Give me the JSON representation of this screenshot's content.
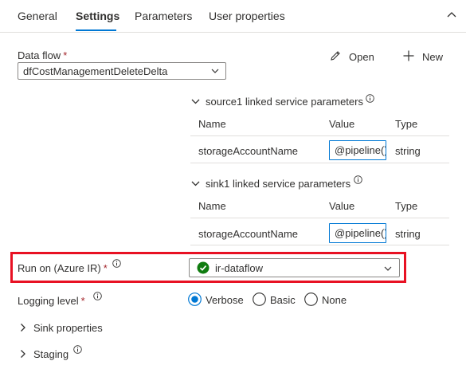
{
  "tabs": [
    {
      "label": "General"
    },
    {
      "label": "Settings"
    },
    {
      "label": "Parameters"
    },
    {
      "label": "User properties"
    }
  ],
  "active_tab": "Settings",
  "data_flow": {
    "label": "Data flow",
    "required_mark": "*",
    "selected": "dfCostManagementDeleteDelta",
    "open_label": "Open",
    "new_label": "New"
  },
  "source_params": {
    "title": "source1 linked service parameters",
    "columns": [
      "Name",
      "Value",
      "Type"
    ],
    "rows": [
      {
        "name": "storageAccountName",
        "value": "@pipeline()",
        "type": "string"
      }
    ]
  },
  "sink_params": {
    "title": "sink1 linked service parameters",
    "columns": [
      "Name",
      "Value",
      "Type"
    ],
    "rows": [
      {
        "name": "storageAccountName",
        "value": "@pipeline()",
        "type": "string"
      }
    ]
  },
  "run_on": {
    "label": "Run on (Azure IR)",
    "required_mark": "*",
    "selected": "ir-dataflow",
    "status_color": "#107c10"
  },
  "logging": {
    "label": "Logging level",
    "required_mark": "*",
    "options": [
      "Verbose",
      "Basic",
      "None"
    ],
    "selected": "Verbose"
  },
  "sections": {
    "sink_properties": "Sink properties",
    "staging": "Staging"
  },
  "colors": {
    "accent": "#0078d4",
    "highlight": "#e81123",
    "text": "#323130"
  }
}
